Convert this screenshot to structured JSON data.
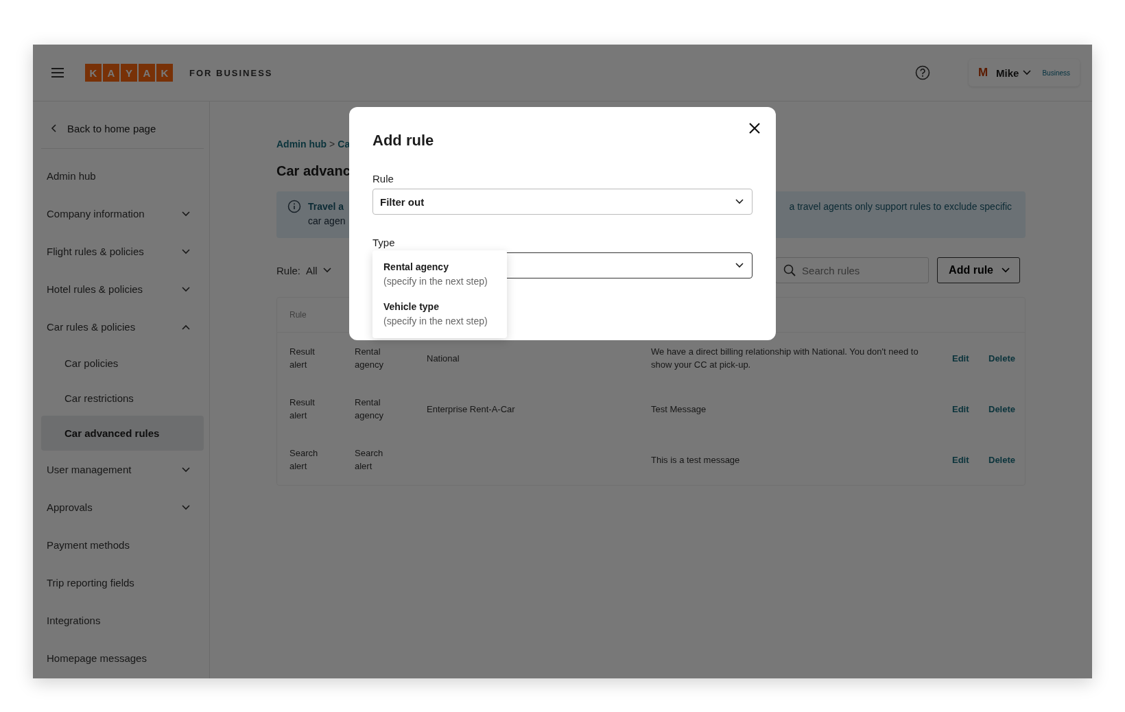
{
  "header": {
    "logo": [
      "K",
      "A",
      "Y",
      "A",
      "K"
    ],
    "logo_suffix": "FOR BUSINESS",
    "user": {
      "initial": "M",
      "name": "Mike",
      "badge": "Business"
    }
  },
  "sidebar": {
    "back": "Back to home page",
    "items": [
      {
        "label": "Admin hub",
        "selected": false
      },
      {
        "label": "Company information",
        "selected": false,
        "expanded": false
      },
      {
        "label": "Flight rules & policies",
        "selected": false,
        "expanded": false
      },
      {
        "label": "Hotel rules & policies",
        "selected": false,
        "expanded": false
      },
      {
        "label": "Car rules & policies",
        "selected": false,
        "expanded": true,
        "children": [
          {
            "label": "Car policies",
            "selected": false
          },
          {
            "label": "Car restrictions",
            "selected": false
          },
          {
            "label": "Car advanced rules",
            "selected": true
          }
        ]
      },
      {
        "label": "User management",
        "selected": false,
        "expanded": false
      },
      {
        "label": "Approvals",
        "selected": false,
        "expanded": false
      },
      {
        "label": "Payment methods",
        "selected": false
      },
      {
        "label": "Trip reporting fields",
        "selected": false
      },
      {
        "label": "Integrations",
        "selected": false
      },
      {
        "label": "Homepage messages",
        "selected": false
      }
    ]
  },
  "breadcrumb": [
    "Admin hub",
    "Ca"
  ],
  "breadcrumb_separator": ">",
  "page_title": "Car advanc",
  "banner": {
    "title": "Travel a",
    "line_2": "car agen",
    "text_right": "a travel agents only support rules to exclude specific"
  },
  "toolbar": {
    "filter_label": "Rule:",
    "filter_value": "All",
    "search": {
      "placeholder": "Search rules"
    },
    "add_button": "Add rule"
  },
  "table": {
    "columns": [
      "Rule"
    ],
    "rows": [
      {
        "rule": "Result alert",
        "type": "Rental agency",
        "value": "National",
        "message": "We have a direct billing relationship with National. You don't need to show your CC at pick-up.",
        "actions": [
          "Edit",
          "Delete"
        ]
      },
      {
        "rule": "Result alert",
        "type": "Rental agency",
        "value": "Enterprise Rent-A-Car",
        "message": "Test Message",
        "actions": [
          "Edit",
          "Delete"
        ]
      },
      {
        "rule": "Search alert",
        "type": "Search alert",
        "message": "This is a test message",
        "actions": [
          "Edit",
          "Delete"
        ]
      }
    ]
  },
  "modal": {
    "title": "Add rule",
    "fields": [
      {
        "label": "Rule",
        "value": "Filter out",
        "focused": false
      },
      {
        "label": "Type",
        "focused": true
      }
    ],
    "options": [
      {
        "title": "Rental agency",
        "hint": "(specify in the next step)",
        "selected": false
      },
      {
        "title": "Vehicle type",
        "hint": "(specify in the next step)",
        "selected": false
      }
    ]
  }
}
